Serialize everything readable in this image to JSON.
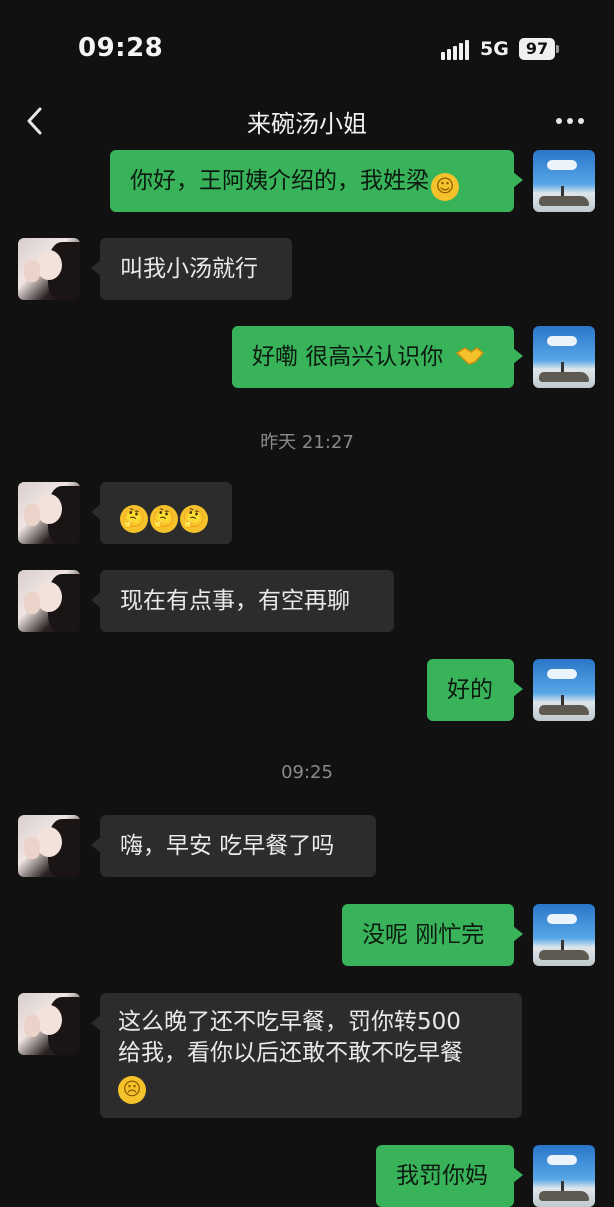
{
  "status_bar": {
    "time": "09:28",
    "network": "5G",
    "battery": "97"
  },
  "nav": {
    "title": "来碗汤小姐"
  },
  "messages": [
    {
      "from": "me",
      "text": "你好，王阿姨介绍的，我姓梁",
      "emoji": "smile"
    },
    {
      "from": "her",
      "text": "叫我小汤就行"
    },
    {
      "from": "me",
      "text": "好嘞 很高兴认识你",
      "emoji": "handshake"
    },
    {
      "type": "timestamp",
      "text": "昨天 21:27"
    },
    {
      "from": "her",
      "text": "",
      "emoji": "thinking x3"
    },
    {
      "from": "her",
      "text": "现在有点事，有空再聊"
    },
    {
      "from": "me",
      "text": "好的"
    },
    {
      "type": "timestamp",
      "text": "09:25"
    },
    {
      "from": "her",
      "text": "嗨，早安 吃早餐了吗"
    },
    {
      "from": "me",
      "text": "没呢 刚忙完"
    },
    {
      "from": "her",
      "line1": "这么晚了还不吃早餐，罚你转500",
      "line2": "给我，看你以后还敢不敢不吃早餐",
      "emoji": "worried"
    },
    {
      "from": "me",
      "text": "我罚你妈"
    }
  ]
}
